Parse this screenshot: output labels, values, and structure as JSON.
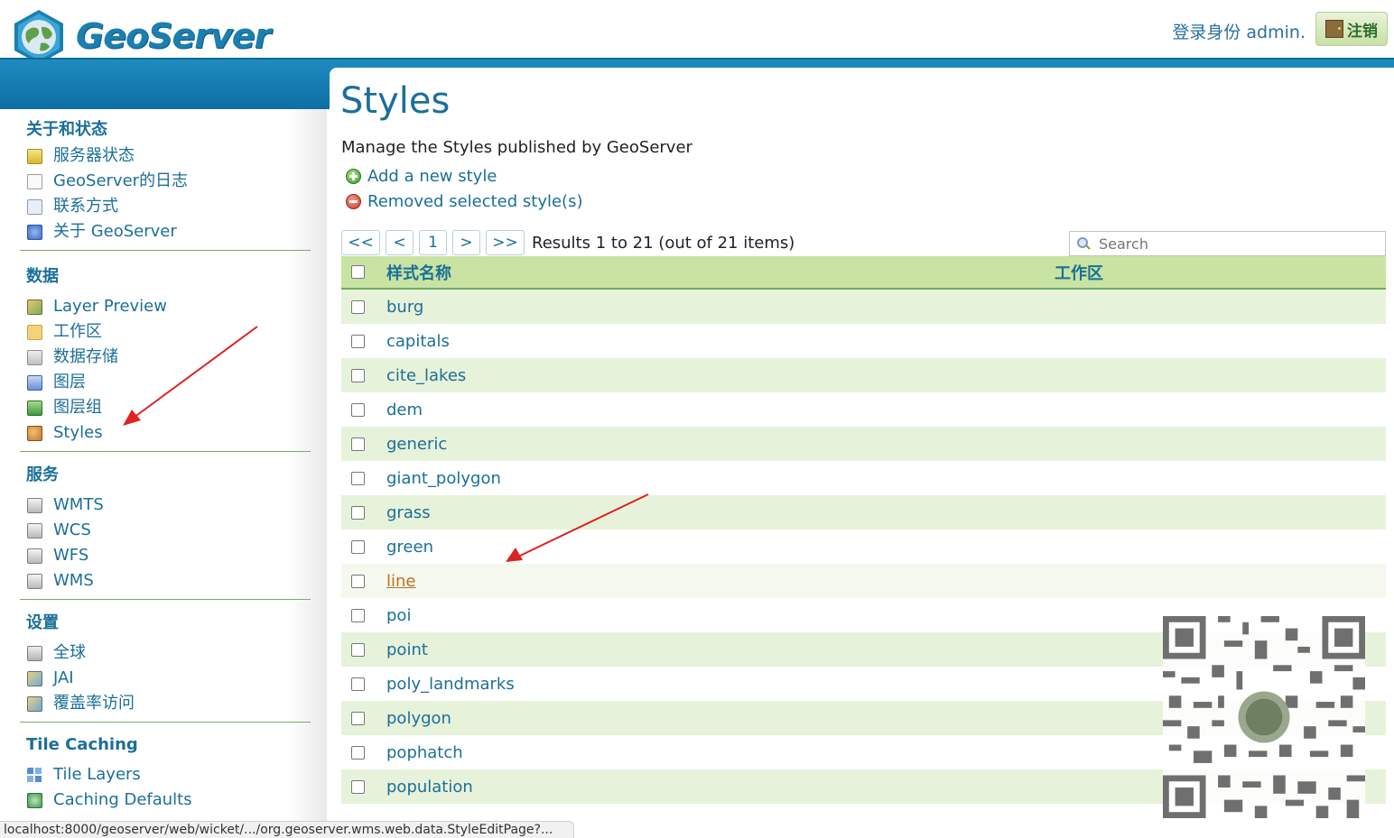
{
  "header": {
    "logo_text": "GeoServer",
    "login_label": "登录身份 admin.",
    "logout_label": "注销"
  },
  "sidebar": {
    "sections": [
      {
        "title": "关于和状态",
        "items": [
          "服务器状态",
          "GeoServer的日志",
          "联系方式",
          "关于 GeoServer"
        ]
      },
      {
        "title": "数据",
        "items": [
          "Layer Preview",
          "工作区",
          "数据存储",
          "图层",
          "图层组",
          "Styles"
        ]
      },
      {
        "title": "服务",
        "items": [
          "WMTS",
          "WCS",
          "WFS",
          "WMS"
        ]
      },
      {
        "title": "设置",
        "items": [
          "全球",
          "JAI",
          "覆盖率访问"
        ]
      },
      {
        "title": "Tile Caching",
        "items": [
          "Tile Layers",
          "Caching Defaults"
        ]
      }
    ]
  },
  "main": {
    "title": "Styles",
    "description": "Manage the Styles published by GeoServer",
    "add_label": "Add a new style",
    "remove_label": "Removed selected style(s)",
    "pager": {
      "first": "<<",
      "prev": "<",
      "page": "1",
      "next": ">",
      "last": ">>"
    },
    "results_text": "Results 1 to 21 (out of 21 items)",
    "search_placeholder": "Search",
    "columns": {
      "name": "样式名称",
      "workspace": "工作区"
    },
    "rows": [
      "burg",
      "capitals",
      "cite_lakes",
      "dem",
      "generic",
      "giant_polygon",
      "grass",
      "green",
      "line",
      "poi",
      "point",
      "poly_landmarks",
      "polygon",
      "pophatch",
      "population"
    ]
  },
  "statusbar": {
    "url": "localhost:8000/geoserver/web/wicket/.../org.geoserver.wms.web.data.StyleEditPage?..."
  },
  "colors": {
    "accent": "#1b6f99",
    "band": "#0d6ea3",
    "row_alt": "#e7f2da",
    "header_green": "#c8e3a2",
    "arrow": "#dd2222"
  }
}
